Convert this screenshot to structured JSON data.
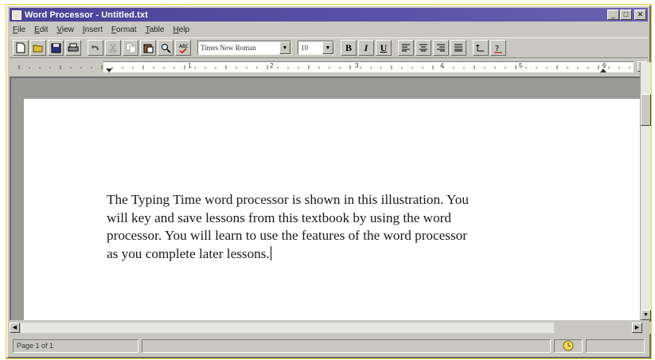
{
  "window": {
    "title": "Word Processor - Untitled.txt",
    "buttons": {
      "minimize": "_",
      "maximize": "□",
      "close": "✕"
    }
  },
  "menu": {
    "items": [
      {
        "first": "F",
        "rest": "ile"
      },
      {
        "first": "E",
        "rest": "dit"
      },
      {
        "first": "V",
        "rest": "iew"
      },
      {
        "first": "I",
        "rest": "nsert"
      },
      {
        "first": "F",
        "rest": "ormat"
      },
      {
        "first": "T",
        "rest": "able"
      },
      {
        "first": "H",
        "rest": "elp"
      }
    ]
  },
  "toolbar": {
    "font_name": "Times New Roman",
    "font_size": "10",
    "bold": "B",
    "italic": "I",
    "underline": "U",
    "dropdown_arrow": "▼",
    "icons": [
      "new-document-icon",
      "open-folder-icon",
      "save-disk-icon",
      "print-icon",
      "undo-icon",
      "cut-icon",
      "copy-icon",
      "paste-icon",
      "find-icon",
      "spell-check-icon",
      "align-left-icon",
      "align-center-icon",
      "align-right-icon",
      "justify-icon",
      "line-spacing-icon",
      "help-icon"
    ]
  },
  "ruler": {
    "numbers": [
      "1",
      "2",
      "3",
      "4",
      "5",
      "6"
    ]
  },
  "document": {
    "lines": [
      "The Typing Time word processor is shown in this illustration. You",
      "will key and save lessons from this textbook by using the word",
      "processor. You will learn to use the features of the word processor",
      "as you complete later lessons."
    ]
  },
  "status": {
    "page": "Page 1 of 1"
  },
  "colors": {
    "titlebar": "#4a4296",
    "chrome": "#c8c8c0",
    "document_bg": "#ffffff",
    "frame_bg": "#9a9a96"
  }
}
